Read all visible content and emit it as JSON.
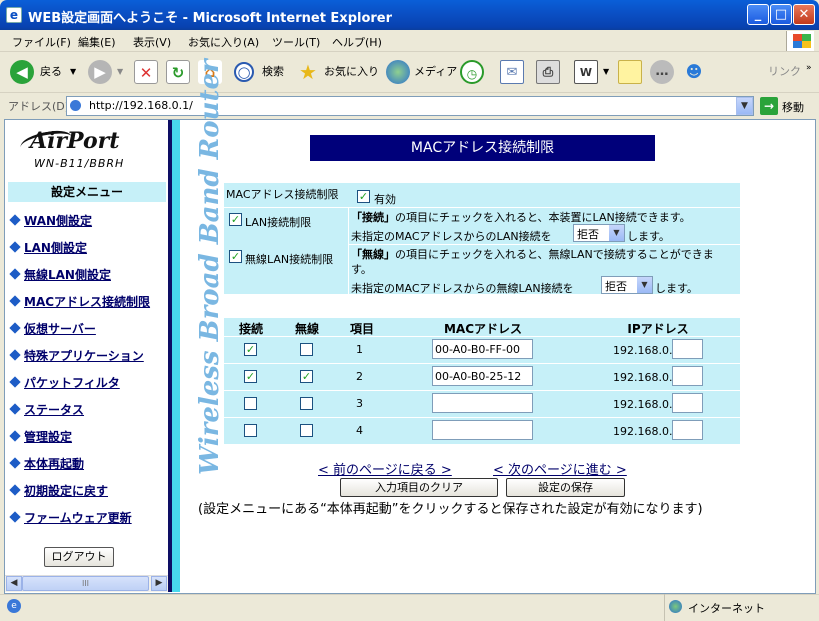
{
  "window": {
    "title": "WEB設定画面へようこそ - Microsoft Internet Explorer",
    "min": "_",
    "max": "□",
    "close": "✕"
  },
  "menubar": [
    "ファイル(F)",
    "編集(E)",
    "表示(V)",
    "お気に入り(A)",
    "ツール(T)",
    "ヘルプ(H)"
  ],
  "toolbar": {
    "back": "戻る",
    "search": "検索",
    "favorites": "お気に入り",
    "media": "メディア",
    "links": "リンク"
  },
  "address": {
    "label": "アドレス(D)",
    "url": "http://192.168.0.1/",
    "go": "移動"
  },
  "sidebar": {
    "logo": "AirPort",
    "model": "WN-B11/BBRH",
    "menu_header": "設定メニュー",
    "items": [
      "WAN側設定",
      "LAN側設定",
      "無線LAN側設定",
      "MACアドレス接続制限",
      "仮想サーバー",
      "特殊アプリケーション",
      "パケットフィルタ",
      "ステータス",
      "管理設定",
      "本体再起動",
      "初期設定に戻す",
      "ファームウェア更新"
    ],
    "logout": "ログアウト"
  },
  "vertical_text": "Wireless Broad Band Router",
  "main": {
    "heading": "MACアドレス接続制限",
    "mac_restrict_label": "MACアドレス接続制限",
    "enable_label": "有効",
    "enable_checked": "✓",
    "lan": {
      "label": "LAN接続制限",
      "checked": "✓",
      "desc_bold": "「接続」",
      "desc1": "の項目にチェックを入れると、本装置にLAN接続できます。",
      "desc2": "未指定のMACアドレスからのLAN接続を",
      "select": "拒否",
      "suffix": "します。"
    },
    "wlan": {
      "label": "無線LAN接続制限",
      "checked": "✓",
      "desc_bold": "「無線」",
      "desc1": "の項目にチェックを入れると、無線LANで接続することができま",
      "desc1b": "す。",
      "desc2": "未指定のMACアドレスからの無線LAN接続を",
      "select": "拒否",
      "suffix": "します。"
    },
    "table": {
      "headers": [
        "接続",
        "無線",
        "項目",
        "MACアドレス",
        "IPアドレス"
      ],
      "rows": [
        {
          "conn": "✓",
          "wireless": "",
          "item": "1",
          "mac": "00-A0-B0-FF-00",
          "ip_prefix": "192.168.0.",
          "ip_last": ""
        },
        {
          "conn": "✓",
          "wireless": "✓",
          "item": "2",
          "mac": "00-A0-B0-25-12",
          "ip_prefix": "192.168.0.",
          "ip_last": ""
        },
        {
          "conn": "",
          "wireless": "",
          "item": "3",
          "mac": "",
          "ip_prefix": "192.168.0.",
          "ip_last": ""
        },
        {
          "conn": "",
          "wireless": "",
          "item": "4",
          "mac": "",
          "ip_prefix": "192.168.0.",
          "ip_last": ""
        }
      ]
    },
    "prev_link": "< 前のページに戻る >",
    "next_link": "< 次のページに進む >",
    "clear_button": "入力項目のクリア",
    "save_button": "設定の保存",
    "note": "(設定メニューにある“本体再起動”をクリックすると保存された設定が有効になります)"
  },
  "status": {
    "icon": "e",
    "zone": "インターネット"
  }
}
